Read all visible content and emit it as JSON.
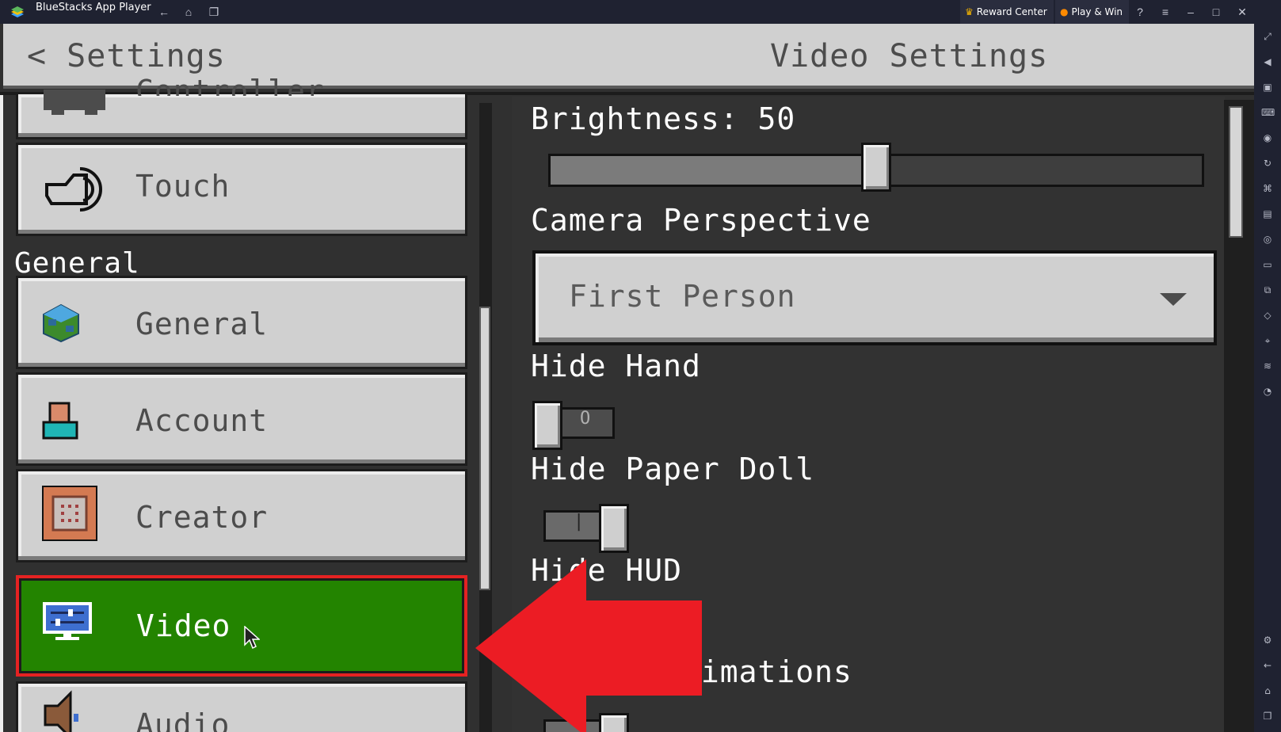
{
  "window": {
    "app_title": "BlueStacks App Player",
    "reward_center": "Reward Center",
    "play_win": "Play & Win"
  },
  "header": {
    "back_label": "< Settings",
    "page_title": "Video Settings"
  },
  "nav": {
    "partial_top_label": "Controller",
    "touch_label": "Touch",
    "section_general": "General",
    "items": [
      {
        "label": "General",
        "icon": "globe-icon"
      },
      {
        "label": "Account",
        "icon": "account-icon"
      },
      {
        "label": "Creator",
        "icon": "command-block-icon"
      },
      {
        "label": "Video",
        "icon": "monitor-sliders-icon",
        "selected": true
      },
      {
        "label": "Audio",
        "icon": "speaker-icon"
      }
    ]
  },
  "settings": {
    "brightness_label": "Brightness: 50",
    "brightness_value": 50,
    "camera_label": "Camera Perspective",
    "camera_value": "First Person",
    "hide_hand_label": "Hide Hand",
    "hide_hand_on": false,
    "hide_paper_doll_label": "Hide Paper Doll",
    "hide_paper_doll_on": true,
    "hide_hud_label_partial": "Hide HUD",
    "screen_animations_label": "Screen Animations"
  },
  "colors": {
    "selected_bg": "#238400",
    "highlight_border": "#e52222",
    "arrow": "#ec1c24"
  }
}
